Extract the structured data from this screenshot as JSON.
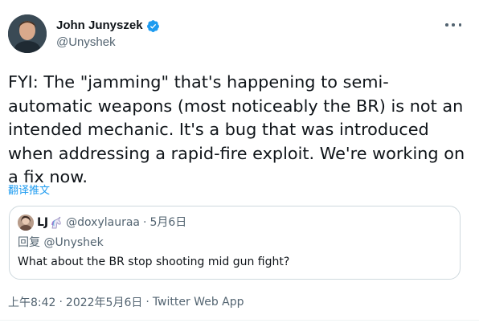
{
  "author": {
    "display_name": "John Junyszek",
    "handle": "@Unyshek",
    "verified_icon": "verified-badge-icon"
  },
  "tweet": {
    "text": "FYI: The \"jamming\" that's happening to semi-\nautomatic weapons (most noticeably the BR) is not an\nintended mechanic. It's a bug that was introduced\nwhen addressing a rapid-fire exploit. We're working on\na fix now.",
    "translate_label": "翻译推文"
  },
  "quoted_tweet": {
    "name": "LJ",
    "emoji_icon": "unicorn-icon",
    "handle": "@doxylauraa",
    "date": "5月6日",
    "reply_prefix": "回复",
    "reply_to": "@Unyshek",
    "text": "What about the BR stop shooting mid gun fight?"
  },
  "meta": {
    "time": "上午8:42",
    "date": "2022年5月6日",
    "source": "Twitter Web App"
  },
  "colors": {
    "link": "#1d9bf0",
    "muted": "#536471",
    "text": "#0f1419",
    "border": "#cfd9de"
  }
}
